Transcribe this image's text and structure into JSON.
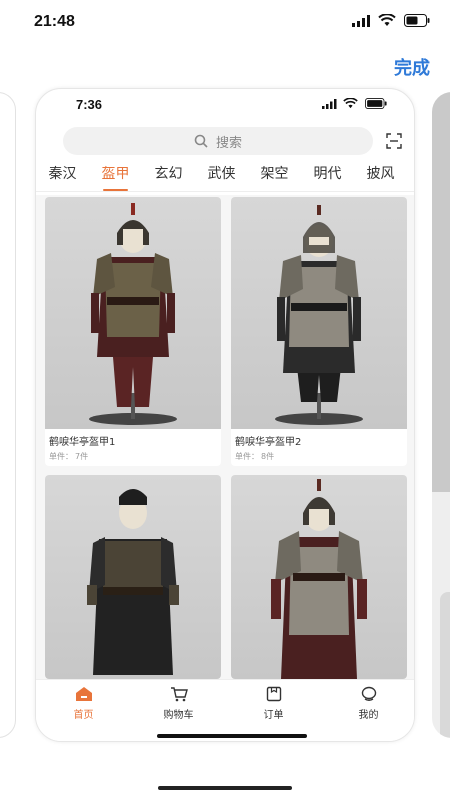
{
  "os_status": {
    "time": "21:48"
  },
  "header": {
    "done_label": "完成"
  },
  "preview": {
    "status_time": "7:36",
    "search": {
      "placeholder": "搜索"
    },
    "categories": [
      "秦汉",
      "盔甲",
      "玄幻",
      "武侠",
      "架空",
      "明代",
      "披风"
    ],
    "active_category_index": 1,
    "products": [
      {
        "name": "鹤唳华亭盔甲1",
        "count_label": "单件：",
        "count_value": "7件"
      },
      {
        "name": "鹤唳华亭盔甲2",
        "count_label": "单件：",
        "count_value": "8件"
      },
      {
        "name": "",
        "count_label": "",
        "count_value": ""
      },
      {
        "name": "",
        "count_label": "",
        "count_value": ""
      }
    ],
    "tabbar": [
      {
        "label": "首页",
        "icon": "home-icon",
        "active": true
      },
      {
        "label": "购物车",
        "icon": "cart-icon",
        "active": false
      },
      {
        "label": "订单",
        "icon": "order-icon",
        "active": false
      },
      {
        "label": "我的",
        "icon": "profile-icon",
        "active": false
      }
    ]
  },
  "colors": {
    "accent": "#e8743a",
    "done_blue": "#2f7ad8",
    "tab_text": "#333333"
  }
}
